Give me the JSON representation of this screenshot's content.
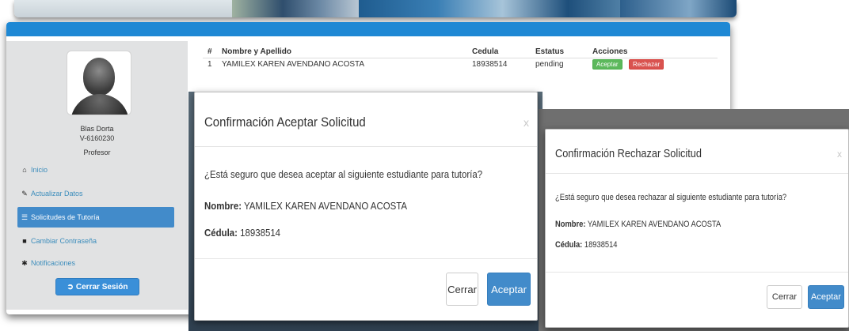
{
  "sidebar": {
    "user_name": "Blas Dorta",
    "user_id": "V-6160230",
    "user_role": "Profesor",
    "items": [
      {
        "label": "Inicio",
        "icon": "home-icon"
      },
      {
        "label": "Actualizar Datos",
        "icon": "edit-icon"
      },
      {
        "label": "Solicitudes de Tutoría",
        "icon": "list-icon"
      },
      {
        "label": "Cambiar Contraseña",
        "icon": "lock-icon"
      },
      {
        "label": "Notificaciones",
        "icon": "asterisk-icon"
      }
    ],
    "logout_label": "Cerrar Sesión"
  },
  "table": {
    "headers": [
      "#",
      "Nombre y Apellido",
      "Cedula",
      "Estatus",
      "Acciones"
    ],
    "rows": [
      {
        "num": "1",
        "name": "YAMILEX KAREN AVENDANO ACOSTA",
        "cedula": "18938514",
        "status": "pending",
        "accept": "Aceptar",
        "reject": "Rechazar"
      }
    ]
  },
  "modal_accept": {
    "title": "Confirmación Aceptar Solicitud",
    "close_x": "x",
    "question": "¿Está seguro que desea aceptar al siguiente estudiante para tutoría?",
    "name_label": "Nombre:",
    "name_value": "YAMILEX KAREN AVENDANO ACOSTA",
    "cedula_label": "Cédula:",
    "cedula_value": "18938514",
    "close_button": "Cerrar",
    "confirm_button": "Aceptar"
  },
  "modal_reject": {
    "title": "Confirmación Rechazar Solicitud",
    "close_x": "x",
    "question": "¿Está seguro que desea rechazar al siguiente estudiante para tutoría?",
    "name_label": "Nombre:",
    "name_value": "YAMILEX KAREN AVENDANO ACOSTA",
    "cedula_label": "Cédula:",
    "cedula_value": "18938514",
    "close_button": "Cerrar",
    "confirm_button": "Aceptar"
  },
  "colors": {
    "primary": "#428bca",
    "topbar": "#1e88d4",
    "success": "#5cb85c",
    "danger": "#d9534f",
    "sidebar_bg": "#e1e2e3"
  }
}
